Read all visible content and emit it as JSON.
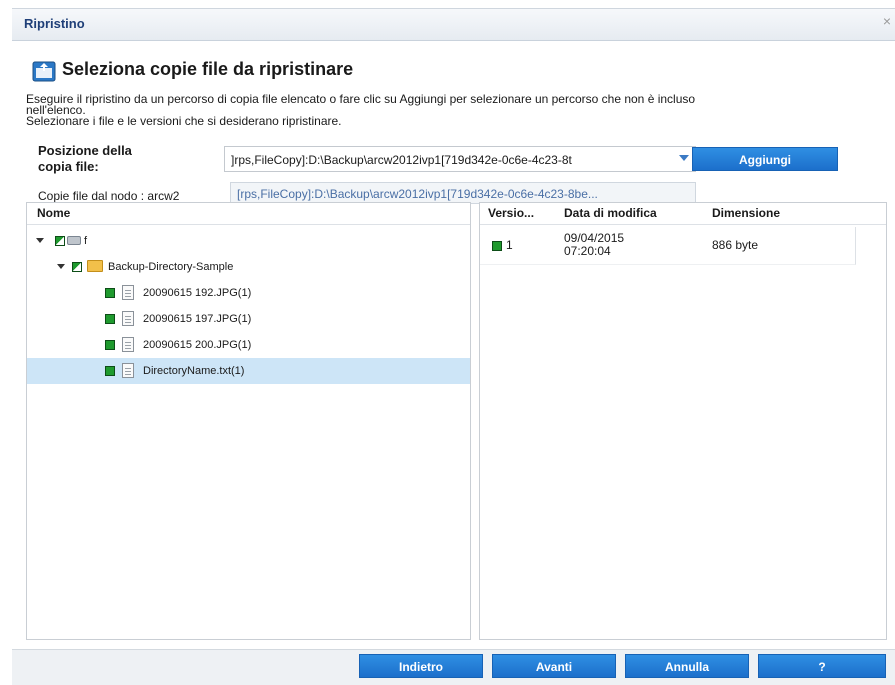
{
  "window": {
    "title": "Ripristino",
    "close_glyph": "×"
  },
  "heading": {
    "icon": "restore-folder-icon",
    "text": "Seleziona copie file da ripristinare"
  },
  "intro": {
    "line1": "Eseguire il ripristino da un percorso di copia file elencato o fare clic su Aggiungi per selezionare un percorso che non è incluso",
    "line2": "nell'elenco.",
    "line3": "Selezionare i file e le versioni che si desiderano ripristinare."
  },
  "location": {
    "label_line1": "Posizione della",
    "label_line2": "copia file:",
    "selected_value": "]rps,FileCopy]:D:\\Backup\\arcw2012ivp1[719d342e-0c6e-4c23-8t",
    "dropdown_option": "[rps,FileCopy]:D:\\Backup\\arcw2012ivp1[719d342e-0c6e-4c23-8be...",
    "add_button": "Aggiungi"
  },
  "node_label": "Copie file dal nodo : arcw2",
  "tree": {
    "header": "Nome",
    "items": [
      {
        "label": "f",
        "type": "drive"
      },
      {
        "label": "Backup-Directory-Sample",
        "type": "folder"
      },
      {
        "label": "20090615 192.JPG(1)",
        "type": "file"
      },
      {
        "label": "20090615 197.JPG(1)",
        "type": "file"
      },
      {
        "label": "20090615 200.JPG(1)",
        "type": "file"
      },
      {
        "label": "DirectoryName.txt(1)",
        "type": "file",
        "selected": true
      }
    ]
  },
  "versions": {
    "headers": [
      "Versio...",
      "Data di modifica",
      "Dimensione"
    ],
    "rows": [
      {
        "version": "1",
        "date_line1": "09/04/2015",
        "date_line2": "07:20:04",
        "size": "886 byte"
      }
    ]
  },
  "footer": {
    "back": "Indietro",
    "next": "Avanti",
    "cancel": "Annulla",
    "help": "?"
  },
  "colors": {
    "accent": "#1c6fcb",
    "title": "#1f3f78",
    "selection": "#cde5f7",
    "check": "#1f9a2e"
  }
}
